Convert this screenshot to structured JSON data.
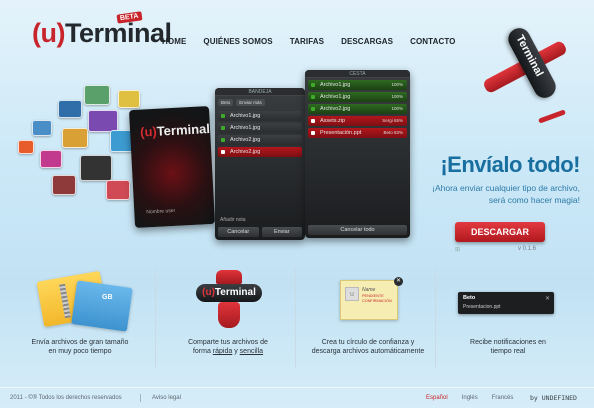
{
  "header": {
    "logo_prefix": "(u)",
    "logo_word": "Terminal",
    "beta": "BETA",
    "nav": [
      "HOME",
      "QUIÉNES SOMOS",
      "TARIFAS",
      "DESCARGAS",
      "CONTACTO"
    ]
  },
  "hero": {
    "panel1": {
      "logo_prefix": "(u)",
      "logo_word": "Terminal",
      "name_label": "Nombre user"
    },
    "panel2": {
      "title": "BANDEJA",
      "toolbar": [
        "Beto",
        "Enviar más"
      ],
      "files": [
        "Archivo1.jpg",
        "Archivo1.jpg",
        "Archivo2.jpg",
        "Archivo2.jpg"
      ],
      "add_label": "Añadir nota",
      "cancel": "Cancelar",
      "send": "Enviar"
    },
    "panel3": {
      "title": "CESTA",
      "files": [
        {
          "name": "Archivo1.jpg",
          "pct": "100%"
        },
        {
          "name": "Archivo1.jpg",
          "pct": "100%"
        },
        {
          "name": "Archivo2.jpg",
          "pct": "100%"
        },
        {
          "name": "Assets.zip",
          "pct": "Sergi 65%"
        },
        {
          "name": "Presentación.ppt",
          "pct": "Beto 83%"
        }
      ],
      "cancel_all": "Cancelar todo"
    },
    "plane_label": "Terminal"
  },
  "cta": {
    "headline": "¡Envíalo todo!",
    "subline": "¡Ahora enviar cualquier tipo de archivo, será como hacer magia!",
    "download": "DESCARGAR",
    "os_icons": "⊞  ",
    "version": "v 0.1.6"
  },
  "features": [
    {
      "text1": "Envía archivos de gran tamaño",
      "text2": "en muy poco tiempo",
      "art_gb": "GB"
    },
    {
      "text1": "Comparte tus archivos de",
      "text2_a": "forma ",
      "rapida": "rápida",
      "y": " y ",
      "sencilla": "sencilla",
      "art_label": "Terminal"
    },
    {
      "text1": "Crea tu círculo de confianza y",
      "text2": "descarga archivos automáticamente",
      "note_name": "Name",
      "note_status": "PENDIENTE CONFIRMACIÓN"
    },
    {
      "text1": "Recibe notificaciones en",
      "text2": "tiempo real",
      "toast_name": "Beto",
      "toast_file": "Presentacion.ppt"
    }
  ],
  "footer": {
    "copy": "2011 - ©® Todos los derechos reservados",
    "legal": "Aviso legal",
    "langs": [
      "Español",
      "Inglés",
      "Francés"
    ],
    "brand": "by UNDEFINED"
  },
  "colors": {
    "brand_red": "#c8242b",
    "headline_blue": "#186f9f"
  }
}
